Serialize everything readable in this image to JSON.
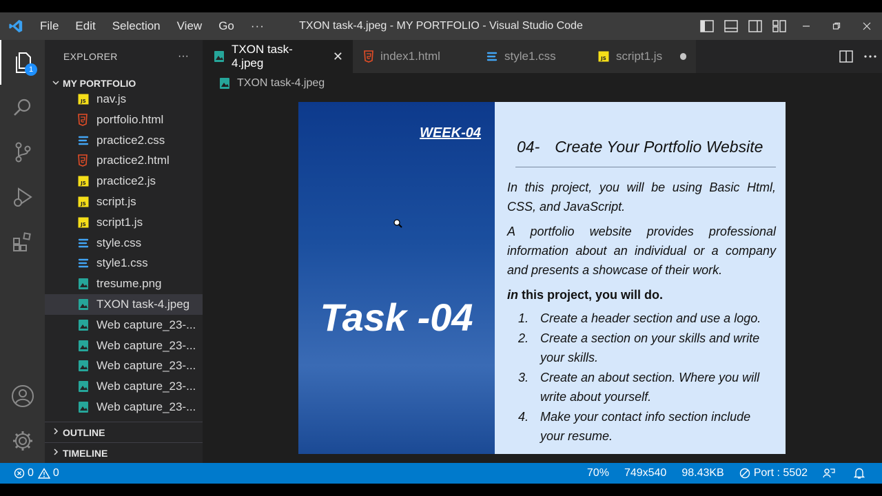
{
  "titlebar": {
    "menu": [
      "File",
      "Edit",
      "Selection",
      "View",
      "Go"
    ],
    "more": "···",
    "window_title": "TXON task-4.jpeg - MY PORTFOLIO - Visual Studio Code"
  },
  "activitybar": {
    "explorer_badge": "1",
    "icons": [
      "files-icon",
      "search-icon",
      "source-control-icon",
      "run-debug-icon",
      "extensions-icon",
      "account-icon",
      "settings-gear-icon"
    ]
  },
  "sidebar": {
    "title": "EXPLORER",
    "more": "···",
    "folder": "MY PORTFOLIO",
    "files": [
      {
        "name": "nav.js",
        "type": "js"
      },
      {
        "name": "portfolio.html",
        "type": "html"
      },
      {
        "name": "practice2.css",
        "type": "css"
      },
      {
        "name": "practice2.html",
        "type": "html"
      },
      {
        "name": "practice2.js",
        "type": "js"
      },
      {
        "name": "script.js",
        "type": "js"
      },
      {
        "name": "script1.js",
        "type": "js"
      },
      {
        "name": "style.css",
        "type": "css"
      },
      {
        "name": "style1.css",
        "type": "css"
      },
      {
        "name": "tresume.png",
        "type": "img"
      },
      {
        "name": "TXON task-4.jpeg",
        "type": "img",
        "selected": true
      },
      {
        "name": "Web capture_23-...",
        "type": "img"
      },
      {
        "name": "Web capture_23-...",
        "type": "img"
      },
      {
        "name": "Web capture_23-...",
        "type": "img"
      },
      {
        "name": "Web capture_23-...",
        "type": "img"
      },
      {
        "name": "Web capture_23-...",
        "type": "img"
      },
      {
        "name": "Web capture_23-...",
        "type": "img"
      }
    ],
    "outline": "OUTLINE",
    "timeline": "TIMELINE"
  },
  "tabs": [
    {
      "label": "TXON task-4.jpeg",
      "type": "img",
      "active": true
    },
    {
      "label": "index1.html",
      "type": "html"
    },
    {
      "label": "style1.css",
      "type": "css"
    },
    {
      "label": "script1.js",
      "type": "js",
      "dirty": true
    }
  ],
  "breadcrumb": "TXON task-4.jpeg",
  "preview": {
    "week": "WEEK-04",
    "task": "Task -04",
    "heading_num": "04-",
    "heading": "Create Your Portfolio Website",
    "p1": "In this project, you will be using Basic Html, CSS, and JavaScript.",
    "p2": "A portfolio website provides professional information about an individual or a company and presents a showcase of their work.",
    "do_prefix": "in",
    "do_rest": " this project, you will do.",
    "items": [
      {
        "n": "1.",
        "t": "Create a header section and use a logo."
      },
      {
        "n": "2.",
        "t": "Create a section on your skills and write your skills."
      },
      {
        "n": "3.",
        "t": "Create an about section. Where you will write about yourself."
      },
      {
        "n": "4.",
        "t": "Make your contact info section include your resume."
      }
    ]
  },
  "statusbar": {
    "errors": "0",
    "warnings": "0",
    "zoom": "70%",
    "dimensions": "749x540",
    "size": "98.43KB",
    "port": "Port : 5502"
  },
  "colors": {
    "accent": "#007acc",
    "html": "#e44d26",
    "css": "#42a5f5",
    "js": "#f5de19",
    "img": "#26a69a"
  }
}
